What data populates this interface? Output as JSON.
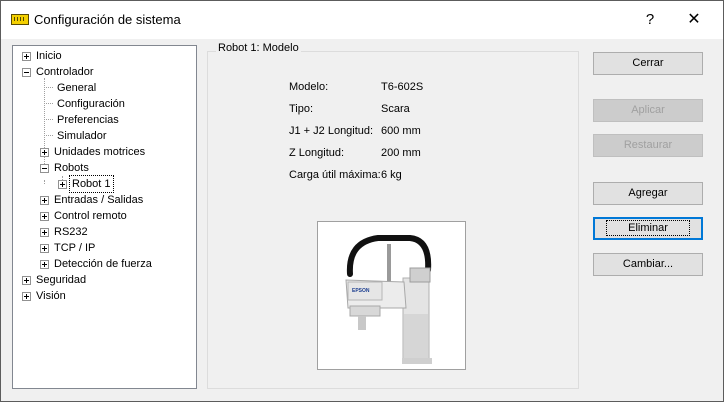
{
  "window": {
    "title": "Configuración de sistema",
    "help_glyph": "?",
    "close_glyph": "✕"
  },
  "tree": {
    "items": [
      {
        "label": "Inicio",
        "expander": "plus"
      },
      {
        "label": "Controlador",
        "expander": "minus"
      },
      {
        "label": "General",
        "expander": "none"
      },
      {
        "label": "Configuración",
        "expander": "none"
      },
      {
        "label": "Preferencias",
        "expander": "none"
      },
      {
        "label": "Simulador",
        "expander": "none"
      },
      {
        "label": "Unidades motrices",
        "expander": "plus"
      },
      {
        "label": "Robots",
        "expander": "minus"
      },
      {
        "label": "Robot 1",
        "expander": "plus",
        "selected": true
      },
      {
        "label": "Entradas / Salidas",
        "expander": "plus"
      },
      {
        "label": "Control remoto",
        "expander": "plus"
      },
      {
        "label": "RS232",
        "expander": "plus"
      },
      {
        "label": "TCP / IP",
        "expander": "plus"
      },
      {
        "label": "Detección de fuerza",
        "expander": "plus"
      },
      {
        "label": "Seguridad",
        "expander": "plus"
      },
      {
        "label": "Visión",
        "expander": "plus"
      }
    ]
  },
  "panel": {
    "title": "Robot 1: Modelo",
    "fields": [
      {
        "label": "Modelo:",
        "value": "T6-602S"
      },
      {
        "label": "Tipo:",
        "value": "Scara"
      },
      {
        "label": "J1 + J2 Longitud:",
        "value": "600 mm"
      },
      {
        "label": "Z Longitud:",
        "value": "200 mm"
      },
      {
        "label": "Carga útil máxima:",
        "value": "6 kg"
      }
    ],
    "image_brand": "EPSON"
  },
  "buttons": {
    "close": "Cerrar",
    "apply": "Aplicar",
    "restore": "Restaurar",
    "add": "Agregar",
    "delete": "Eliminar",
    "change": "Cambiar..."
  },
  "colors": {
    "focus_border": "#0078d7",
    "title_icon": "#f4d000",
    "disabled_text": "#a0a0a0"
  }
}
